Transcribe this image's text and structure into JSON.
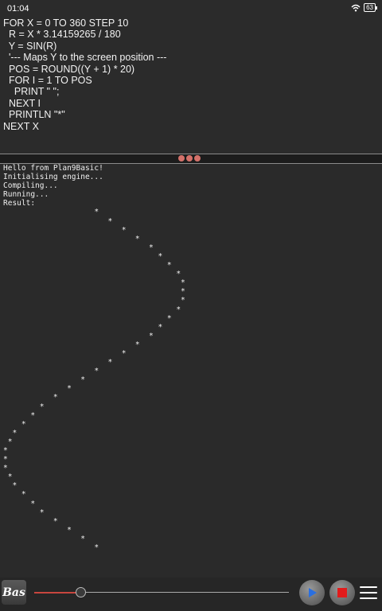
{
  "status": {
    "time": "01:04",
    "battery": "63",
    "wifi_icon": "wifi-icon"
  },
  "editor": {
    "lines": [
      "FOR X = 0 TO 360 STEP 10",
      "  R = X * 3.14159265 / 180",
      "  Y = SIN(R)",
      "  '--- Maps Y to the screen position ---",
      "  POS = ROUND((Y + 1) * 20)",
      "  FOR I = 1 TO POS",
      "    PRINT \" \";",
      "  NEXT I",
      "  PRINTLN \"*\"",
      "NEXT X"
    ]
  },
  "console": {
    "lines": [
      "Hello from Plan9Basic!",
      "Initialising engine...",
      "Compiling...",
      "Running...",
      "Result:",
      "                    *",
      "                       *",
      "                          *",
      "                             *",
      "                                *",
      "                                  *",
      "                                    *",
      "                                      *",
      "                                       *",
      "                                       *",
      "                                       *",
      "                                      *",
      "                                    *",
      "                                  *",
      "                                *",
      "                             *",
      "                          *",
      "                       *",
      "                    *",
      "                 *",
      "              *",
      "           *",
      "        *",
      "      *",
      "    *",
      "  *",
      " *",
      "*",
      "*",
      "*",
      " *",
      "  *",
      "    *",
      "      *",
      "        *",
      "           *",
      "              *",
      "                 *",
      "                    *"
    ]
  },
  "toolbar": {
    "logo": "Bas",
    "progress": 0.18,
    "colors": {
      "accent": "#c8463e",
      "play": "#2a6fe0",
      "stop": "#e21b1b"
    }
  }
}
